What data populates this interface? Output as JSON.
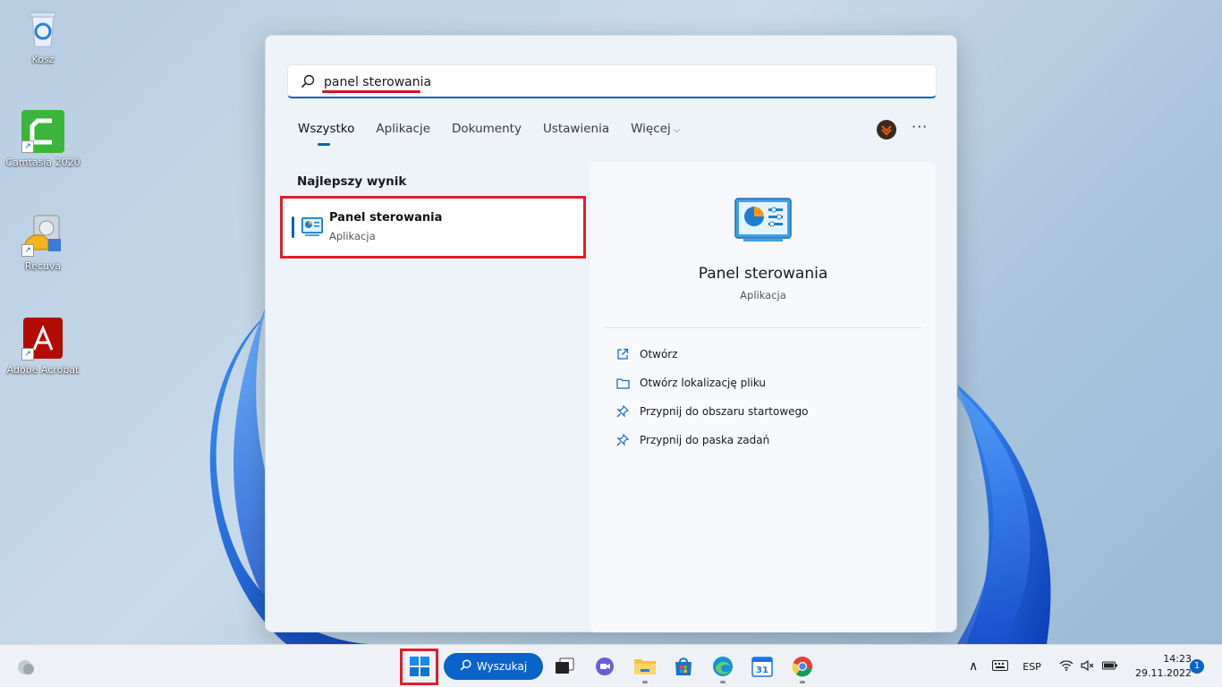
{
  "desktop": {
    "icons": [
      {
        "label": "Kosz",
        "icon": "recycle-bin-icon"
      },
      {
        "label": "Camtasia 2020",
        "icon": "camtasia-icon"
      },
      {
        "label": "Recuva",
        "icon": "recuva-icon"
      },
      {
        "label": "Adobe Acrobat",
        "icon": "acrobat-icon"
      }
    ]
  },
  "search": {
    "query": "panel sterowania",
    "tabs": [
      {
        "label": "Wszystko",
        "active": true
      },
      {
        "label": "Aplikacje"
      },
      {
        "label": "Dokumenty"
      },
      {
        "label": "Ustawienia"
      },
      {
        "label": "Więcej"
      }
    ],
    "more_label": "···",
    "best_match_label": "Najlepszy wynik",
    "best_match": {
      "title": "Panel sterowania",
      "subtitle": "Aplikacja"
    },
    "detail": {
      "title": "Panel sterowania",
      "subtitle": "Aplikacja",
      "actions": [
        {
          "label": "Otwórz",
          "icon": "open-external-icon"
        },
        {
          "label": "Otwórz lokalizację pliku",
          "icon": "folder-icon"
        },
        {
          "label": "Przypnij do obszaru startowego",
          "icon": "pin-icon"
        },
        {
          "label": "Przypnij do paska zadań",
          "icon": "pin-icon"
        }
      ]
    }
  },
  "taskbar": {
    "search_label": "Wyszukaj",
    "language": "ESP",
    "time": "14:23",
    "date": "29.11.2022",
    "notification_count": "1"
  },
  "colors": {
    "accent": "#0a63c9",
    "highlight_box": "#e01e2b"
  }
}
